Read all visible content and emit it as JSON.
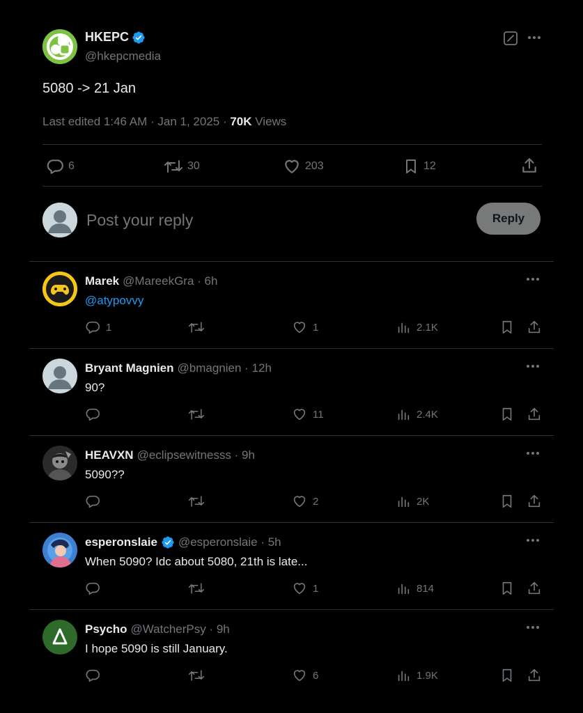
{
  "tweet": {
    "author_name": "HKEPC",
    "author_handle": "@hkepcmedia",
    "verified_icon": "verified-badge-icon",
    "body": "5080 -> 21 Jan",
    "meta_prefix": "Last edited 1:46 AM · Jan 1, 2025 · ",
    "views_count": "70K",
    "views_label": "Views",
    "stats": {
      "replies": "6",
      "retweets": "30",
      "likes": "203",
      "bookmarks": "12"
    }
  },
  "composer": {
    "placeholder": "Post your reply",
    "reply_label": "Reply"
  },
  "replies": [
    {
      "name": "Marek",
      "handle_time": "@MareekGra · 6h",
      "text": "@atypovvy",
      "replies": "1",
      "retweets": "",
      "likes": "1",
      "views": "2.1K"
    },
    {
      "name": "Bryant Magnien",
      "handle_time": "@bmagnien · 12h",
      "text": "90?",
      "replies": "",
      "retweets": "",
      "likes": "11",
      "views": "2.4K"
    },
    {
      "name": "HEAVXN",
      "handle_time": "@eclipsewitnesss · 9h",
      "text": "5090??",
      "replies": "",
      "retweets": "",
      "likes": "2",
      "views": "2K"
    },
    {
      "name": "esperonslaie",
      "handle_time": "@esperonslaie · 5h",
      "text": "When 5090? Idc about 5080, 21th is late...",
      "replies": "",
      "retweets": "",
      "likes": "1",
      "views": "814"
    },
    {
      "name": "Psycho",
      "handle_time": "@WatcherPsy · 9h",
      "text": "I hope 5090 is still January.",
      "replies": "",
      "retweets": "",
      "likes": "6",
      "views": "1.9K"
    }
  ],
  "colors": {
    "background": "#000000",
    "text": "#e7e9ea",
    "muted": "#71767b",
    "link": "#1d9bf0",
    "verified": "#1d9bf0",
    "divider": "#2f3336"
  }
}
